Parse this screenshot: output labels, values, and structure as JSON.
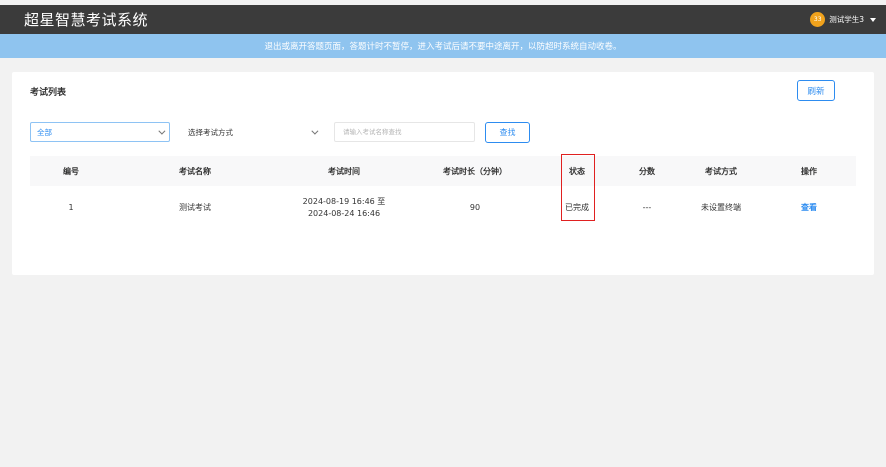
{
  "header": {
    "app_title": "超星智慧考试系统",
    "avatar_text": "33",
    "user_name": "测试学生3"
  },
  "notice": "退出或离开答题页面，答题计时不暂停，进入考试后请不要中途离开，以防超时系统自动收卷。",
  "main": {
    "card_title": "考试列表",
    "refresh_label": "刷新",
    "filters": {
      "status_selected": "全部",
      "method_selected": "选择考试方式",
      "search_placeholder": "请输入考试名称查找",
      "search_label": "查找"
    },
    "table": {
      "headers": [
        "编号",
        "考试名称",
        "考试时间",
        "考试时长（分钟）",
        "状态",
        "分数",
        "考试方式",
        "操作"
      ],
      "rows": [
        {
          "id": "1",
          "name": "测试考试",
          "time_start": "2024-08-19 16:46 至",
          "time_end": "2024-08-24 16:46",
          "duration": "90",
          "status": "已完成",
          "score": "---",
          "method": "未设置终端",
          "action": "查看"
        }
      ]
    }
  },
  "colors": {
    "topbar": "#3b3b3b",
    "notice_bg": "#8fc4ef",
    "accent": "#2d8cf0",
    "highlight": "#e02020",
    "avatar": "#f0a21c"
  }
}
